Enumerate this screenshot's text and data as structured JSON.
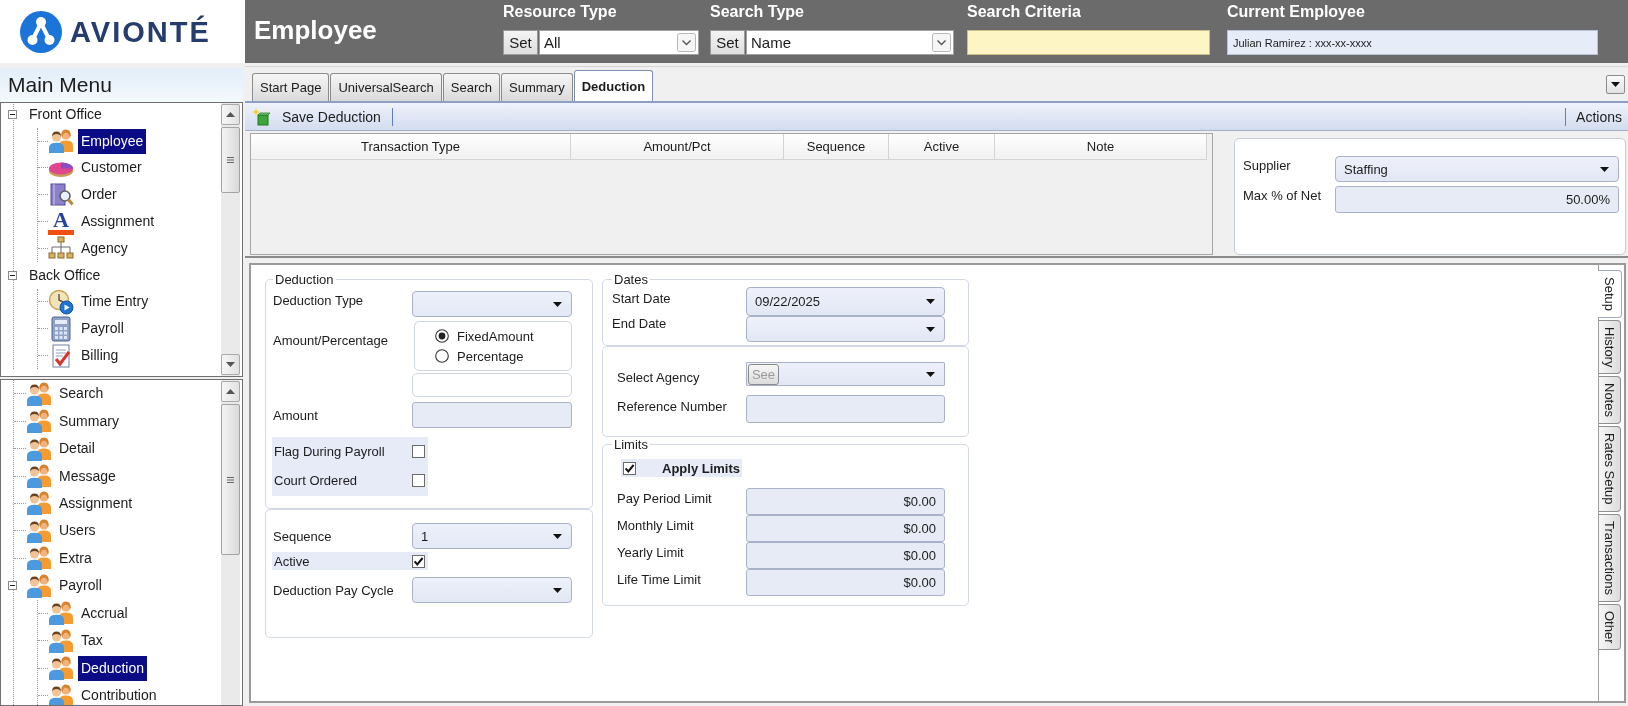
{
  "header": {
    "logo": "AVIONTÉ",
    "title": "Employee",
    "resource_type": {
      "label": "Resource Type",
      "set_button": "Set",
      "value": "All"
    },
    "search_type": {
      "label": "Search Type",
      "set_button": "Set",
      "value": "Name"
    },
    "search_criteria": {
      "label": "Search Criteria"
    },
    "current_employee": {
      "label": "Current Employee",
      "value": "Julian Ramirez : xxx-xx-xxxx"
    }
  },
  "sidebar": {
    "title": "Main Menu",
    "top_tree": [
      {
        "label": "Front Office",
        "kind": "group",
        "selected": false,
        "expanded": true,
        "children": [
          {
            "label": "Employee",
            "kind": "people",
            "selected": true
          },
          {
            "label": "Customer",
            "kind": "disc",
            "selected": false
          },
          {
            "label": "Order",
            "kind": "book",
            "selected": false
          },
          {
            "label": "Assignment",
            "kind": "letter",
            "glyph": "A",
            "selected": false
          },
          {
            "label": "Agency",
            "kind": "org-chart",
            "selected": false
          }
        ]
      },
      {
        "label": "Back Office",
        "kind": "group",
        "selected": false,
        "expanded": true,
        "children": [
          {
            "label": "Time Entry",
            "kind": "clock",
            "selected": false
          },
          {
            "label": "Payroll",
            "kind": "calculator",
            "selected": false
          },
          {
            "label": "Billing",
            "kind": "document",
            "selected": false
          }
        ]
      }
    ],
    "bottom_tree": [
      {
        "label": "Search",
        "kind": "people",
        "selected": false
      },
      {
        "label": "Summary",
        "kind": "people",
        "selected": false
      },
      {
        "label": "Detail",
        "kind": "people",
        "selected": false
      },
      {
        "label": "Message",
        "kind": "people",
        "selected": false
      },
      {
        "label": "Assignment",
        "kind": "people",
        "selected": false
      },
      {
        "label": "Users",
        "kind": "people",
        "selected": false
      },
      {
        "label": "Extra",
        "kind": "people",
        "selected": false
      },
      {
        "label": "Payroll",
        "kind": "people",
        "selected": false,
        "expanded": true,
        "children": [
          {
            "label": "Accrual",
            "kind": "people",
            "selected": false
          },
          {
            "label": "Tax",
            "kind": "people",
            "selected": false
          },
          {
            "label": "Deduction",
            "kind": "people",
            "selected": true
          },
          {
            "label": "Contribution",
            "kind": "people",
            "selected": false
          }
        ]
      }
    ]
  },
  "tabs": [
    {
      "label": "Start Page",
      "selected": false
    },
    {
      "label": "UniversalSearch",
      "selected": false
    },
    {
      "label": "Search",
      "selected": false
    },
    {
      "label": "Summary",
      "selected": false
    },
    {
      "label": "Deduction",
      "selected": true
    }
  ],
  "toolbar": {
    "save_button": "Save Deduction",
    "actions_button": "Actions"
  },
  "transactions_table": {
    "columns": [
      "Transaction Type",
      "Amount/Pct",
      "Sequence",
      "Active",
      "Note"
    ]
  },
  "supplier_panel": {
    "fields": [
      {
        "kind": "dropdown",
        "label": "Supplier",
        "value": "Staffing"
      },
      {
        "kind": "number",
        "label": "Max % of Net",
        "value": "50.00%"
      }
    ]
  },
  "setup_form": {
    "deduction": {
      "title": "Deduction",
      "fields": [
        {
          "kind": "dropdown",
          "label": "Deduction Type"
        },
        {
          "kind": "radio",
          "label": "Amount/Percentage",
          "options": [
            {
              "label": "FixedAmount",
              "selected": true
            },
            {
              "label": "Percentage",
              "selected": false
            }
          ]
        },
        {
          "kind": "entry"
        },
        {
          "kind": "text",
          "label": "Amount"
        },
        {
          "kind": "checkbox",
          "label": "Flag During Payroll",
          "checked": false
        },
        {
          "kind": "checkbox",
          "label": "Court Ordered",
          "checked": false
        }
      ]
    },
    "sequence": {
      "fields": [
        {
          "kind": "dropdown",
          "label": "Sequence",
          "value": "1"
        },
        {
          "kind": "checkbox",
          "label": "Active",
          "checked": true
        },
        {
          "kind": "dropdown",
          "label": "Deduction Pay Cycle"
        }
      ]
    },
    "dates": {
      "title": "Dates",
      "fields": [
        {
          "kind": "date",
          "label": "Start Date",
          "value": "09/22/2025"
        },
        {
          "kind": "date",
          "label": "End Date"
        }
      ]
    },
    "agency": {
      "fields": [
        {
          "kind": "lookup",
          "label": "Select Agency",
          "button": "See",
          "disabled": true
        },
        {
          "kind": "text",
          "label": "Reference Number"
        }
      ]
    },
    "limits": {
      "title": "Limits",
      "apply": {
        "label": "Apply Limits",
        "checked": true
      },
      "fields": [
        {
          "kind": "number",
          "label": "Pay Period Limit",
          "value": "$0.00"
        },
        {
          "kind": "number",
          "label": "Monthly Limit",
          "value": "$0.00"
        },
        {
          "kind": "number",
          "label": "Yearly Limit",
          "value": "$0.00"
        },
        {
          "kind": "number",
          "label": "Life Time Limit",
          "value": "$0.00"
        }
      ]
    }
  },
  "side_tabs": [
    {
      "label": "Setup",
      "selected": true
    },
    {
      "label": "History",
      "selected": false
    },
    {
      "label": "Notes",
      "selected": false
    },
    {
      "label": "Rates Setup",
      "selected": false
    },
    {
      "label": "Transactions",
      "selected": false
    },
    {
      "label": "Other",
      "selected": false
    }
  ]
}
